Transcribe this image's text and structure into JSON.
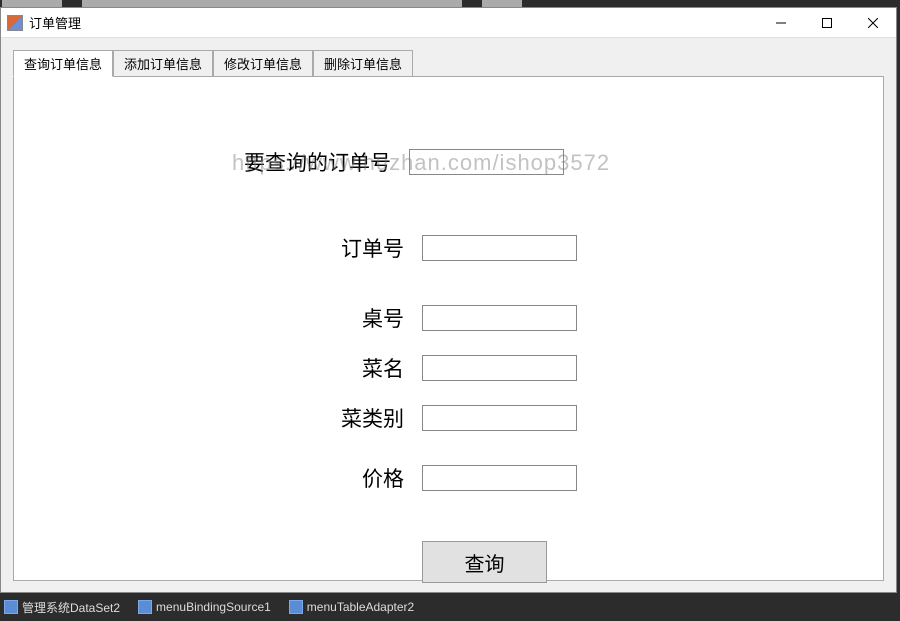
{
  "window": {
    "title": "订单管理"
  },
  "tabs": [
    {
      "label": "查询订单信息",
      "active": true
    },
    {
      "label": "添加订单信息",
      "active": false
    },
    {
      "label": "修改订单信息",
      "active": false
    },
    {
      "label": "删除订单信息",
      "active": false
    }
  ],
  "watermark": "https://www.huzhan.com/ishop3572",
  "form": {
    "query_order_label": "要查询的订单号",
    "query_order_value": "",
    "order_no_label": "订单号",
    "order_no_value": "",
    "table_no_label": "桌号",
    "table_no_value": "",
    "dish_name_label": "菜名",
    "dish_name_value": "",
    "dish_category_label": "菜类别",
    "dish_category_value": "",
    "price_label": "价格",
    "price_value": "",
    "query_button": "查询"
  },
  "tray": {
    "item1": "管理系统DataSet2",
    "item2": "menuBindingSource1",
    "item3": "menuTableAdapter2"
  }
}
